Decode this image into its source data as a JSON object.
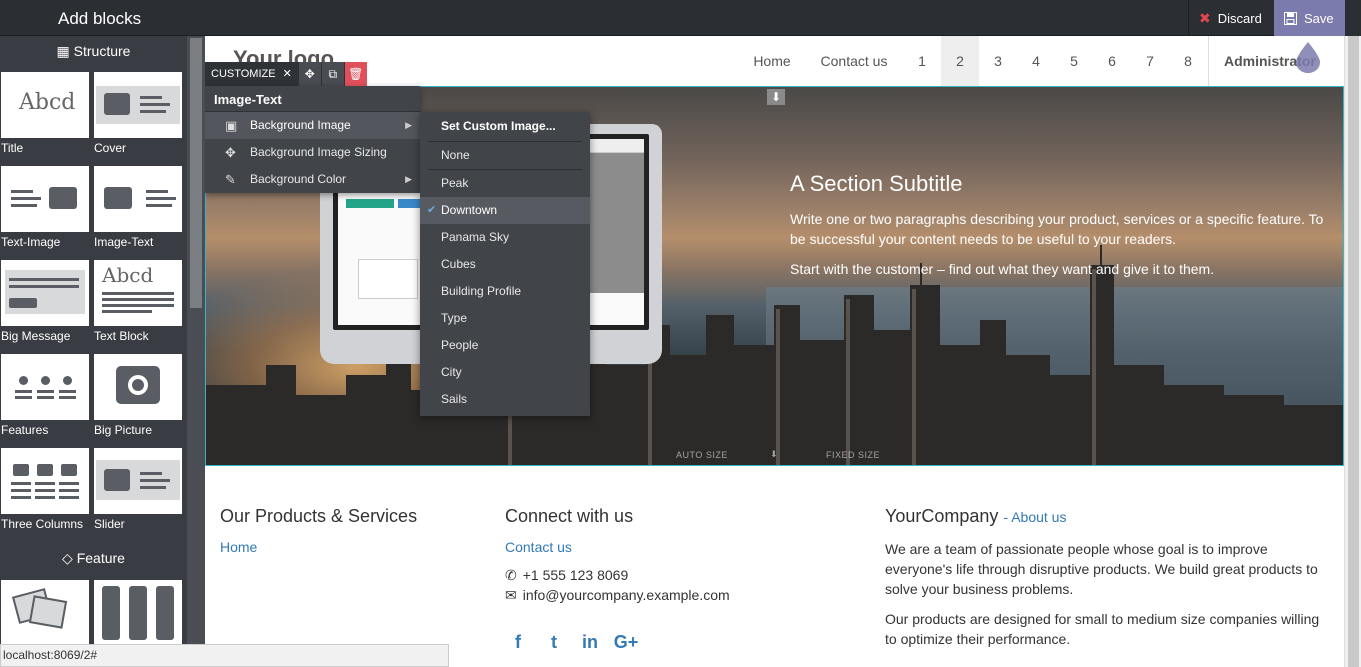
{
  "topbar": {
    "title": "Add blocks",
    "discard_label": "Discard",
    "save_label": "Save"
  },
  "left_panel": {
    "structure_heading": "Structure",
    "feature_heading": "Feature",
    "blocks": [
      "Title",
      "Cover",
      "Text-Image",
      "Image-Text",
      "Big Message",
      "Text Block",
      "Features",
      "Big Picture",
      "Three Columns",
      "Slider"
    ]
  },
  "navbar": {
    "logo": "Your logo",
    "items": [
      "Home",
      "Contact us",
      "1",
      "2",
      "3",
      "4",
      "5",
      "6",
      "7",
      "8"
    ],
    "active_item": "2",
    "admin": "Administrator"
  },
  "customize": {
    "label": "CUSTOMIZE",
    "menu_title": "Image-Text",
    "menu_items": [
      "Background Image",
      "Background Image Sizing",
      "Background Color"
    ],
    "submenu": [
      "Set Custom Image...",
      "None",
      "Peak",
      "Downtown",
      "Panama Sky",
      "Cubes",
      "Building Profile",
      "Type",
      "People",
      "City",
      "Sails"
    ],
    "selected": "Downtown"
  },
  "hero": {
    "title": "A Section Subtitle",
    "p1": "Write one or two paragraphs describing your product, services or a specific feature. To be successful your content needs to be useful to your readers.",
    "p2": "Start with the customer – find out what they want and give it to them.",
    "size_auto": "AUTO SIZE",
    "size_fixed": "FIXED SIZE"
  },
  "footer": {
    "col1_title": "Our Products & Services",
    "col1_link": "Home",
    "col2_title": "Connect with us",
    "col2_link": "Contact us",
    "phone": "+1 555 123 8069",
    "email": "info@yourcompany.example.com",
    "col3_title": "YourCompany",
    "col3_sub": "- About us",
    "about1": "We are a team of passionate people whose goal is to improve everyone's life through disruptive products. We build great products to solve your business problems.",
    "about2": "Our products are designed for small to medium size companies willing to optimize their performance."
  },
  "status_url": "localhost:8069/2#",
  "colors": {
    "accent": "#7c7bad",
    "panel": "#393c42",
    "link": "#337ab7",
    "delete": "#e0505b"
  }
}
